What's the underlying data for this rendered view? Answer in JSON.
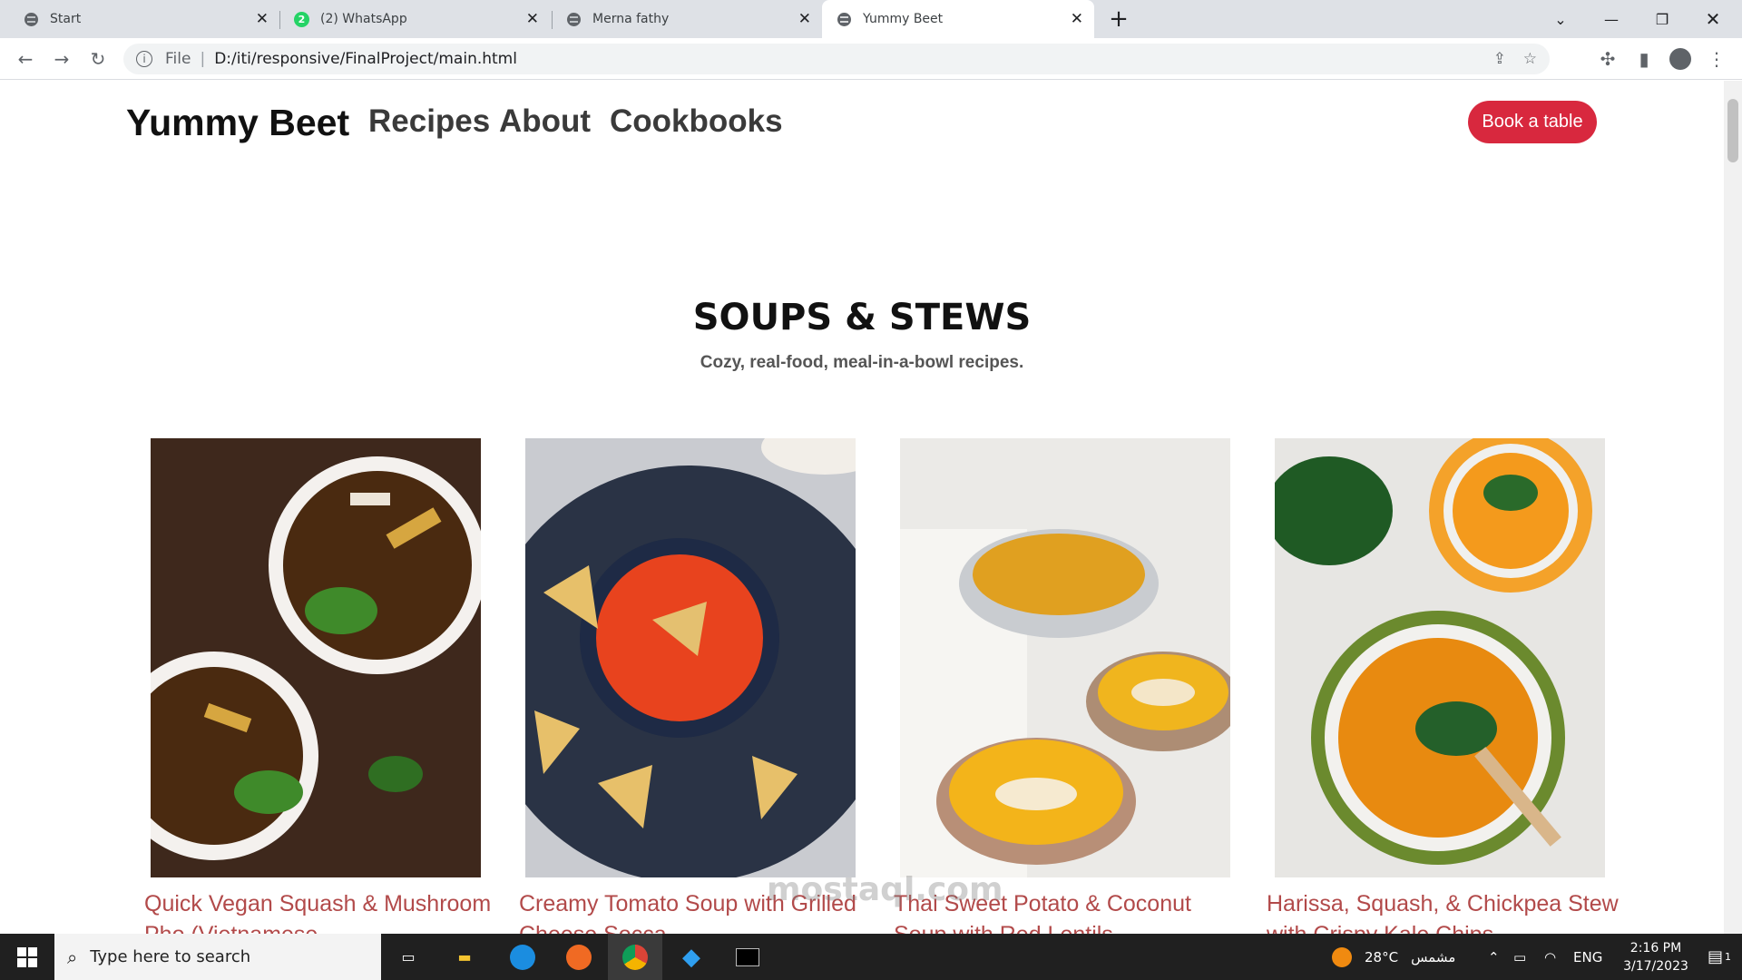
{
  "browser": {
    "tabs": [
      {
        "label": "Start"
      },
      {
        "label": "(2) WhatsApp",
        "badge": "2"
      },
      {
        "label": "Merna fathy"
      },
      {
        "label": "Yummy Beet"
      }
    ],
    "url_prefix": "File",
    "url": "D:/iti/responsive/FinalProject/main.html"
  },
  "site": {
    "brand": "Yummy Beet",
    "nav": [
      "Recipes",
      "About",
      "Cookbooks"
    ],
    "cta": "Book a table",
    "section_title": "SOUPS & STEWS",
    "section_subtitle": "Cozy, real-food, meal-in-a-bowl recipes.",
    "cards": [
      {
        "title": "Quick Vegan Squash & Mushroom Pho (Vietnamese"
      },
      {
        "title": "Creamy Tomato Soup with Grilled Cheese Socca"
      },
      {
        "title": "Thai Sweet Potato & Coconut Soup with Red Lentils"
      },
      {
        "title": "Harissa, Squash, & Chickpea Stew with Crispy Kale Chips"
      }
    ]
  },
  "taskbar": {
    "search_placeholder": "Type here to search",
    "weather_temp": "28°C",
    "weather_desc": "مشمس",
    "lang": "ENG",
    "time": "2:16 PM",
    "date": "3/17/2023",
    "notification_count": "1"
  },
  "watermark": "mostaql.com",
  "colors": {
    "accent": "#d8283e",
    "card_title": "#b24a4a"
  }
}
